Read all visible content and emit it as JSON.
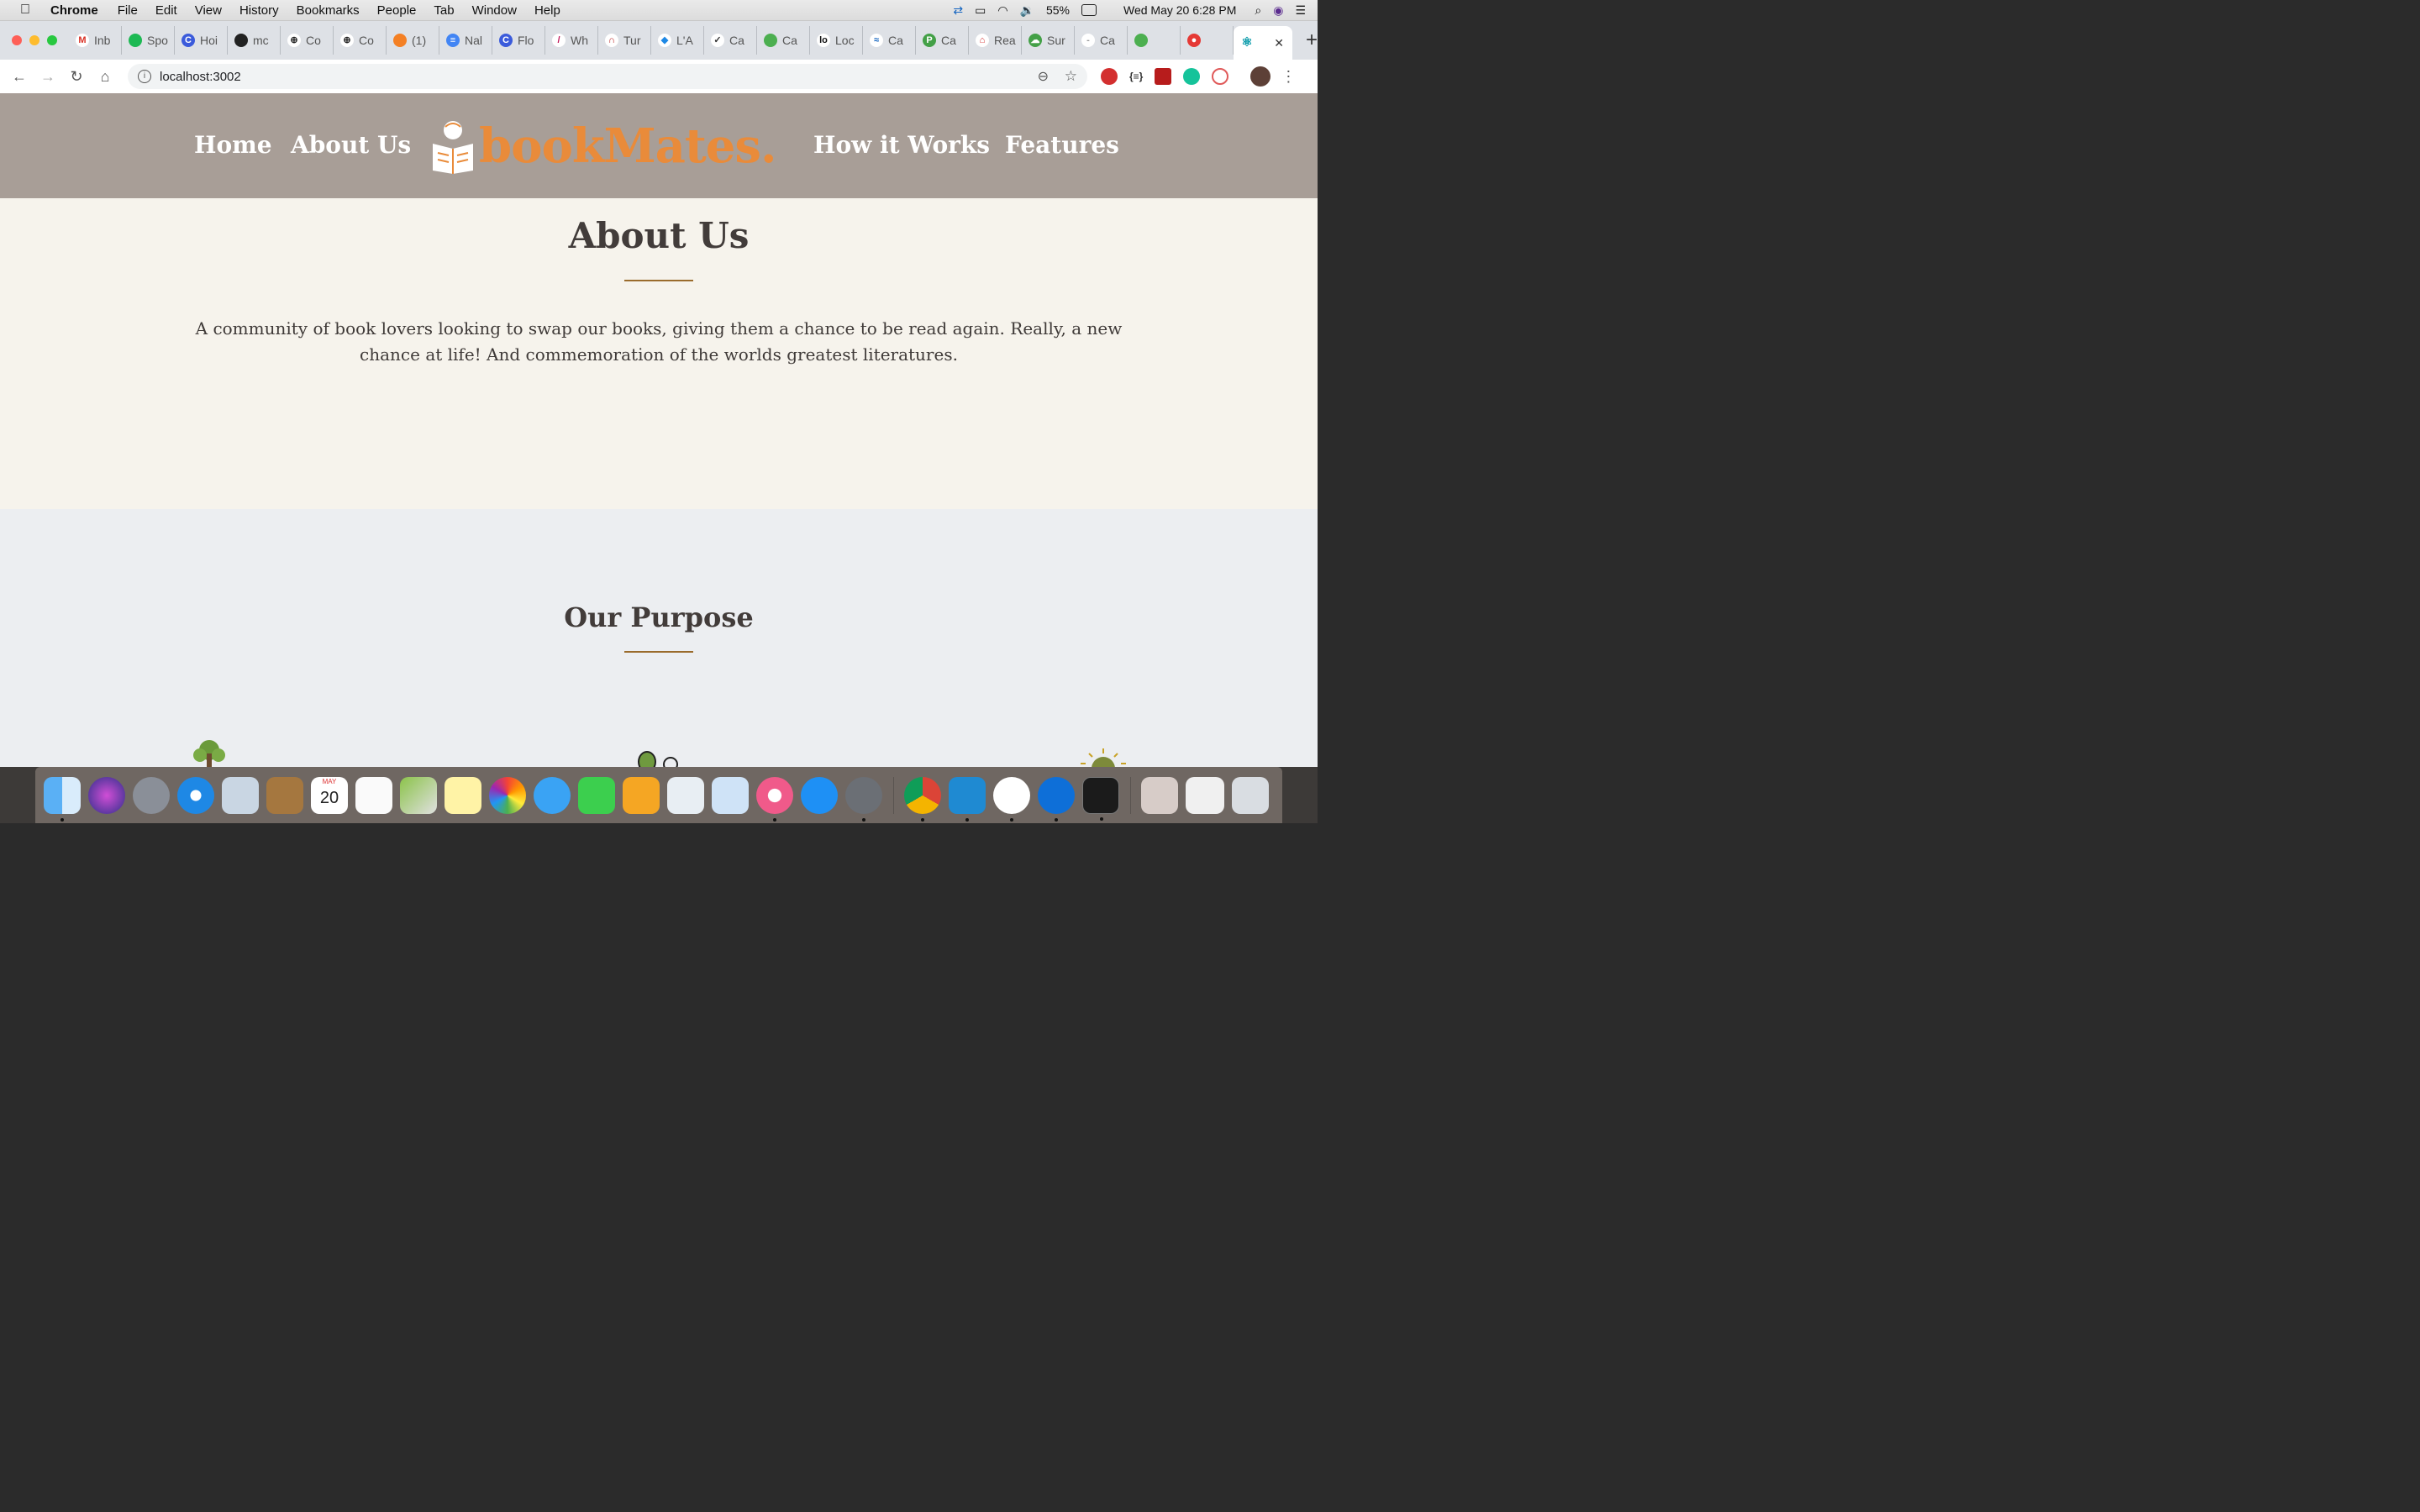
{
  "menubar": {
    "app_name": "Chrome",
    "items": [
      "File",
      "Edit",
      "View",
      "History",
      "Bookmarks",
      "People",
      "Tab",
      "Window",
      "Help"
    ],
    "battery": "55%",
    "datetime": "Wed May 20  6:28 PM"
  },
  "tabs": [
    {
      "label": "Inb",
      "color": "#ffffff",
      "icon": "gmail-icon",
      "glyph": "M",
      "glyph_color": "#d93025"
    },
    {
      "label": "Spo",
      "color": "#1db954",
      "icon": "spotify-icon",
      "glyph": "",
      "glyph_color": "#fff"
    },
    {
      "label": "Hoi",
      "color": "#3b5bdb",
      "icon": "c-icon",
      "glyph": "C",
      "glyph_color": "#fff"
    },
    {
      "label": "mc",
      "color": "#222222",
      "icon": "github-icon",
      "glyph": "",
      "glyph_color": "#fff"
    },
    {
      "label": "Co",
      "color": "#ffffff",
      "icon": "plus-circle-icon",
      "glyph": "⊕",
      "glyph_color": "#222"
    },
    {
      "label": "Co",
      "color": "#ffffff",
      "icon": "plus-circle-icon",
      "glyph": "⊕",
      "glyph_color": "#222"
    },
    {
      "label": "(1)",
      "color": "#f48024",
      "icon": "stackoverflow-icon",
      "glyph": "",
      "glyph_color": "#fff"
    },
    {
      "label": "Nal",
      "color": "#4285f4",
      "icon": "docs-icon",
      "glyph": "≡",
      "glyph_color": "#fff"
    },
    {
      "label": "Flo",
      "color": "#3b5bdb",
      "icon": "c-icon",
      "glyph": "C",
      "glyph_color": "#fff"
    },
    {
      "label": "Wh",
      "color": "#ffffff",
      "icon": "slash-icon",
      "glyph": "/",
      "glyph_color": "#c2185b"
    },
    {
      "label": "Tur",
      "color": "#ffffff",
      "icon": "magnet-icon",
      "glyph": "∩",
      "glyph_color": "#b71c1c"
    },
    {
      "label": "L'A",
      "color": "#ffffff",
      "icon": "diamond-icon",
      "glyph": "◆",
      "glyph_color": "#1e88e5"
    },
    {
      "label": "Ca",
      "color": "#ffffff",
      "icon": "check-circle-icon",
      "glyph": "✓",
      "glyph_color": "#333"
    },
    {
      "label": "Ca",
      "color": "#4caf50",
      "icon": "kibana-icon",
      "glyph": "",
      "glyph_color": "#fff"
    },
    {
      "label": "Loc",
      "color": "#ffffff",
      "icon": "loom-icon",
      "glyph": "lo",
      "glyph_color": "#111"
    },
    {
      "label": "Ca",
      "color": "#ffffff",
      "icon": "fish-icon",
      "glyph": "≈",
      "glyph_color": "#1565c0"
    },
    {
      "label": "Ca",
      "color": "#43a047",
      "icon": "p-icon",
      "glyph": "P",
      "glyph_color": "#fff"
    },
    {
      "label": "Rea",
      "color": "#ffffff",
      "icon": "house-icon",
      "glyph": "⌂",
      "glyph_color": "#d32f2f"
    },
    {
      "label": "Sur",
      "color": "#43a047",
      "icon": "cloud-icon",
      "glyph": "☁",
      "glyph_color": "#fff"
    },
    {
      "label": "Ca",
      "color": "#ffffff",
      "icon": "dash-icon",
      "glyph": "-",
      "glyph_color": "#999"
    },
    {
      "label": "",
      "color": "#4caf50",
      "icon": "chat-icon",
      "glyph": "",
      "glyph_color": "#fff"
    },
    {
      "label": "",
      "color": "#e53935",
      "icon": "record-icon",
      "glyph": "●",
      "glyph_color": "#fff"
    }
  ],
  "active_tab": {
    "icon": "react-icon",
    "close": "✕"
  },
  "new_tab": "+",
  "url": "localhost:3002",
  "site": {
    "nav_left": [
      "Home",
      "About Us"
    ],
    "nav_right": [
      "How it Works",
      "Features"
    ],
    "logo_text": "bookMates.",
    "about_title": "About Us",
    "about_text": "A community of book lovers looking to swap our books, giving them a chance to be read again. Really, a new chance at life! And commemoration of the worlds greatest literatures.",
    "purpose_title": "Our Purpose"
  },
  "calendar": {
    "month": "MAY",
    "day": "20"
  },
  "colors": {
    "header": "#a89e97",
    "logo": "#e98b3a",
    "about_bg": "#f6f3ec",
    "purpose_bg": "#eceef1",
    "rule": "#9a6b2c"
  }
}
